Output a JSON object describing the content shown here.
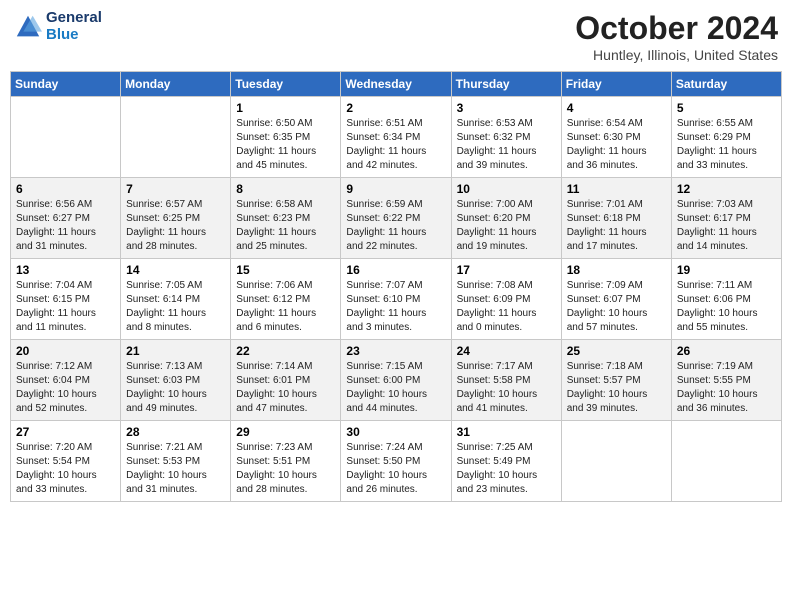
{
  "logo": {
    "general": "General",
    "blue": "Blue"
  },
  "header": {
    "month": "October 2024",
    "location": "Huntley, Illinois, United States"
  },
  "days_of_week": [
    "Sunday",
    "Monday",
    "Tuesday",
    "Wednesday",
    "Thursday",
    "Friday",
    "Saturday"
  ],
  "weeks": [
    [
      null,
      null,
      {
        "day": 1,
        "sunrise": "6:50 AM",
        "sunset": "6:35 PM",
        "daylight": "11 hours and 45 minutes."
      },
      {
        "day": 2,
        "sunrise": "6:51 AM",
        "sunset": "6:34 PM",
        "daylight": "11 hours and 42 minutes."
      },
      {
        "day": 3,
        "sunrise": "6:53 AM",
        "sunset": "6:32 PM",
        "daylight": "11 hours and 39 minutes."
      },
      {
        "day": 4,
        "sunrise": "6:54 AM",
        "sunset": "6:30 PM",
        "daylight": "11 hours and 36 minutes."
      },
      {
        "day": 5,
        "sunrise": "6:55 AM",
        "sunset": "6:29 PM",
        "daylight": "11 hours and 33 minutes."
      }
    ],
    [
      {
        "day": 6,
        "sunrise": "6:56 AM",
        "sunset": "6:27 PM",
        "daylight": "11 hours and 31 minutes."
      },
      {
        "day": 7,
        "sunrise": "6:57 AM",
        "sunset": "6:25 PM",
        "daylight": "11 hours and 28 minutes."
      },
      {
        "day": 8,
        "sunrise": "6:58 AM",
        "sunset": "6:23 PM",
        "daylight": "11 hours and 25 minutes."
      },
      {
        "day": 9,
        "sunrise": "6:59 AM",
        "sunset": "6:22 PM",
        "daylight": "11 hours and 22 minutes."
      },
      {
        "day": 10,
        "sunrise": "7:00 AM",
        "sunset": "6:20 PM",
        "daylight": "11 hours and 19 minutes."
      },
      {
        "day": 11,
        "sunrise": "7:01 AM",
        "sunset": "6:18 PM",
        "daylight": "11 hours and 17 minutes."
      },
      {
        "day": 12,
        "sunrise": "7:03 AM",
        "sunset": "6:17 PM",
        "daylight": "11 hours and 14 minutes."
      }
    ],
    [
      {
        "day": 13,
        "sunrise": "7:04 AM",
        "sunset": "6:15 PM",
        "daylight": "11 hours and 11 minutes."
      },
      {
        "day": 14,
        "sunrise": "7:05 AM",
        "sunset": "6:14 PM",
        "daylight": "11 hours and 8 minutes."
      },
      {
        "day": 15,
        "sunrise": "7:06 AM",
        "sunset": "6:12 PM",
        "daylight": "11 hours and 6 minutes."
      },
      {
        "day": 16,
        "sunrise": "7:07 AM",
        "sunset": "6:10 PM",
        "daylight": "11 hours and 3 minutes."
      },
      {
        "day": 17,
        "sunrise": "7:08 AM",
        "sunset": "6:09 PM",
        "daylight": "11 hours and 0 minutes."
      },
      {
        "day": 18,
        "sunrise": "7:09 AM",
        "sunset": "6:07 PM",
        "daylight": "10 hours and 57 minutes."
      },
      {
        "day": 19,
        "sunrise": "7:11 AM",
        "sunset": "6:06 PM",
        "daylight": "10 hours and 55 minutes."
      }
    ],
    [
      {
        "day": 20,
        "sunrise": "7:12 AM",
        "sunset": "6:04 PM",
        "daylight": "10 hours and 52 minutes."
      },
      {
        "day": 21,
        "sunrise": "7:13 AM",
        "sunset": "6:03 PM",
        "daylight": "10 hours and 49 minutes."
      },
      {
        "day": 22,
        "sunrise": "7:14 AM",
        "sunset": "6:01 PM",
        "daylight": "10 hours and 47 minutes."
      },
      {
        "day": 23,
        "sunrise": "7:15 AM",
        "sunset": "6:00 PM",
        "daylight": "10 hours and 44 minutes."
      },
      {
        "day": 24,
        "sunrise": "7:17 AM",
        "sunset": "5:58 PM",
        "daylight": "10 hours and 41 minutes."
      },
      {
        "day": 25,
        "sunrise": "7:18 AM",
        "sunset": "5:57 PM",
        "daylight": "10 hours and 39 minutes."
      },
      {
        "day": 26,
        "sunrise": "7:19 AM",
        "sunset": "5:55 PM",
        "daylight": "10 hours and 36 minutes."
      }
    ],
    [
      {
        "day": 27,
        "sunrise": "7:20 AM",
        "sunset": "5:54 PM",
        "daylight": "10 hours and 33 minutes."
      },
      {
        "day": 28,
        "sunrise": "7:21 AM",
        "sunset": "5:53 PM",
        "daylight": "10 hours and 31 minutes."
      },
      {
        "day": 29,
        "sunrise": "7:23 AM",
        "sunset": "5:51 PM",
        "daylight": "10 hours and 28 minutes."
      },
      {
        "day": 30,
        "sunrise": "7:24 AM",
        "sunset": "5:50 PM",
        "daylight": "10 hours and 26 minutes."
      },
      {
        "day": 31,
        "sunrise": "7:25 AM",
        "sunset": "5:49 PM",
        "daylight": "10 hours and 23 minutes."
      },
      null,
      null
    ]
  ]
}
